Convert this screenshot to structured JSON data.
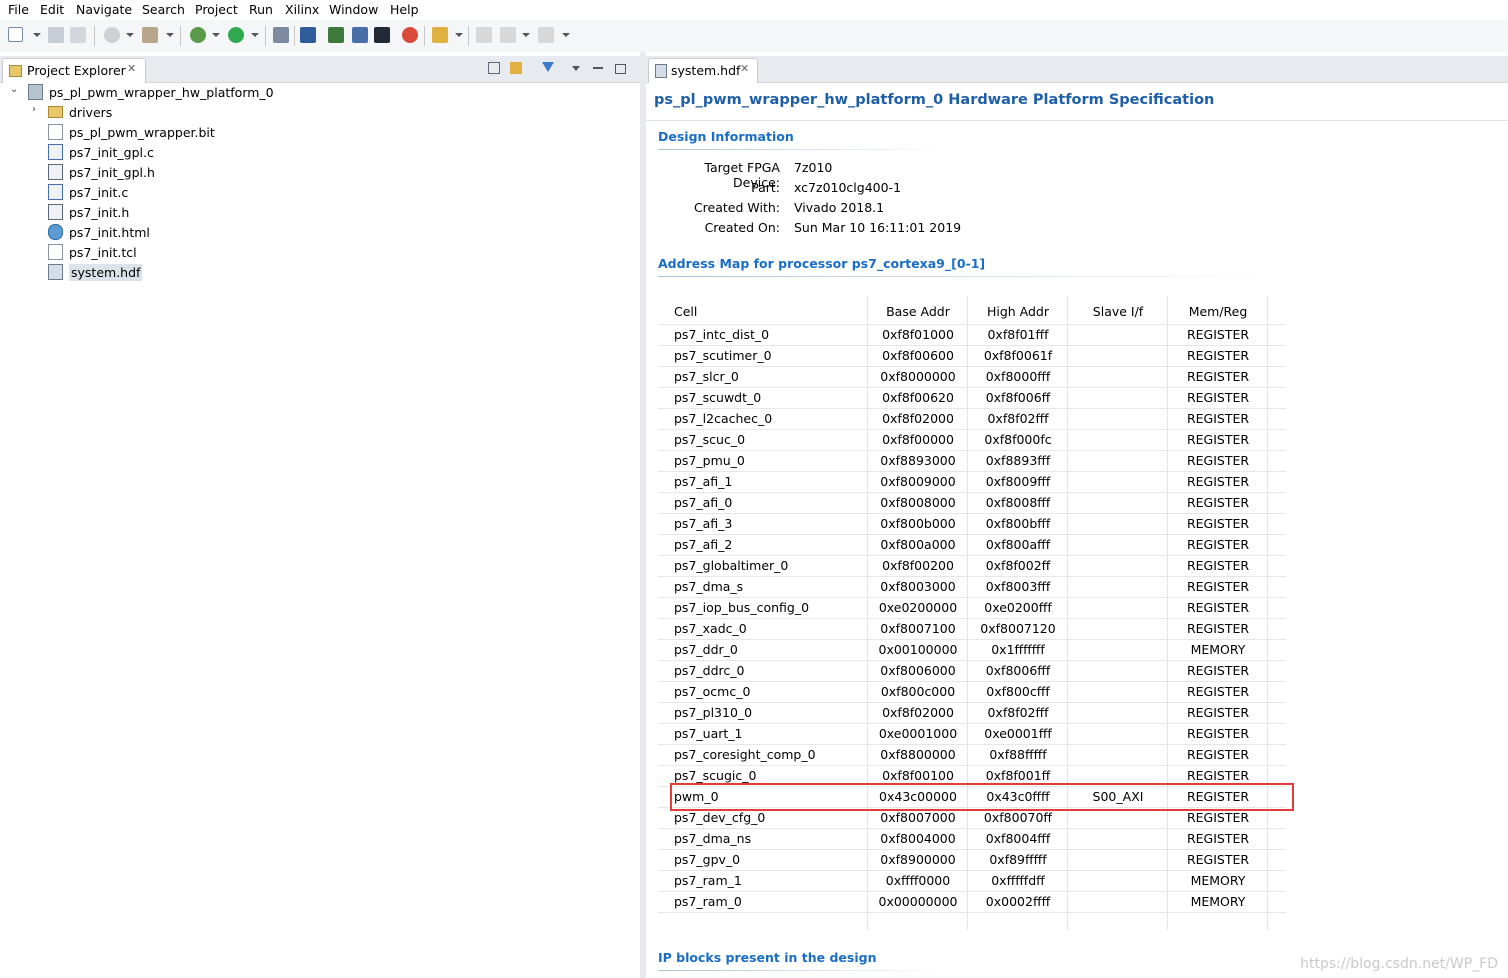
{
  "menu": [
    "File",
    "Edit",
    "Navigate",
    "Search",
    "Project",
    "Run",
    "Xilinx",
    "Window",
    "Help"
  ],
  "colors": {
    "accent": "#1a6dc5",
    "title": "#1f5fa8",
    "highlight": "#e23b3b",
    "selection": "#dde3ea"
  },
  "explorer": {
    "tab_label": "Project Explorer",
    "close_glyph": "✕",
    "root": "ps_pl_pwm_wrapper_hw_platform_0",
    "items": [
      {
        "label": "drivers",
        "icon": "folder-icon"
      },
      {
        "label": "ps_pl_pwm_wrapper.bit",
        "icon": "file-icon"
      },
      {
        "label": "ps7_init_gpl.c",
        "icon": "c-file-icon"
      },
      {
        "label": "ps7_init_gpl.h",
        "icon": "h-file-icon"
      },
      {
        "label": "ps7_init.c",
        "icon": "c-file-icon"
      },
      {
        "label": "ps7_init.h",
        "icon": "h-file-icon"
      },
      {
        "label": "ps7_init.html",
        "icon": "globe-icon"
      },
      {
        "label": "ps7_init.tcl",
        "icon": "file-icon"
      },
      {
        "label": "system.hdf",
        "icon": "hdf-file-icon"
      }
    ],
    "expand_glyph": "⌄",
    "collapsed_glyph": "›"
  },
  "editor": {
    "tab_label": "system.hdf",
    "close_glyph": "✕",
    "title": "ps_pl_pwm_wrapper_hw_platform_0 Hardware Platform Specification",
    "design_info_title": "Design Information",
    "design_info": [
      {
        "key": "Target FPGA Device:",
        "value": "7z010"
      },
      {
        "key": "Part:",
        "value": "xc7z010clg400-1"
      },
      {
        "key": "Created With:",
        "value": "Vivado 2018.1"
      },
      {
        "key": "Created On:",
        "value": "Sun Mar 10 16:11:01 2019"
      }
    ],
    "address_map_title": "Address Map for processor ps7_cortexa9_[0-1]",
    "columns": {
      "cell": "Cell",
      "base": "Base Addr",
      "high": "High Addr",
      "slave": "Slave I/f",
      "mem": "Mem/Reg"
    },
    "rows": [
      {
        "cell": "ps7_intc_dist_0",
        "base": "0xf8f01000",
        "high": "0xf8f01fff",
        "slave": "",
        "mem": "REGISTER"
      },
      {
        "cell": "ps7_scutimer_0",
        "base": "0xf8f00600",
        "high": "0xf8f0061f",
        "slave": "",
        "mem": "REGISTER"
      },
      {
        "cell": "ps7_slcr_0",
        "base": "0xf8000000",
        "high": "0xf8000fff",
        "slave": "",
        "mem": "REGISTER"
      },
      {
        "cell": "ps7_scuwdt_0",
        "base": "0xf8f00620",
        "high": "0xf8f006ff",
        "slave": "",
        "mem": "REGISTER"
      },
      {
        "cell": "ps7_l2cachec_0",
        "base": "0xf8f02000",
        "high": "0xf8f02fff",
        "slave": "",
        "mem": "REGISTER"
      },
      {
        "cell": "ps7_scuc_0",
        "base": "0xf8f00000",
        "high": "0xf8f000fc",
        "slave": "",
        "mem": "REGISTER"
      },
      {
        "cell": "ps7_pmu_0",
        "base": "0xf8893000",
        "high": "0xf8893fff",
        "slave": "",
        "mem": "REGISTER"
      },
      {
        "cell": "ps7_afi_1",
        "base": "0xf8009000",
        "high": "0xf8009fff",
        "slave": "",
        "mem": "REGISTER"
      },
      {
        "cell": "ps7_afi_0",
        "base": "0xf8008000",
        "high": "0xf8008fff",
        "slave": "",
        "mem": "REGISTER"
      },
      {
        "cell": "ps7_afi_3",
        "base": "0xf800b000",
        "high": "0xf800bfff",
        "slave": "",
        "mem": "REGISTER"
      },
      {
        "cell": "ps7_afi_2",
        "base": "0xf800a000",
        "high": "0xf800afff",
        "slave": "",
        "mem": "REGISTER"
      },
      {
        "cell": "ps7_globaltimer_0",
        "base": "0xf8f00200",
        "high": "0xf8f002ff",
        "slave": "",
        "mem": "REGISTER"
      },
      {
        "cell": "ps7_dma_s",
        "base": "0xf8003000",
        "high": "0xf8003fff",
        "slave": "",
        "mem": "REGISTER"
      },
      {
        "cell": "ps7_iop_bus_config_0",
        "base": "0xe0200000",
        "high": "0xe0200fff",
        "slave": "",
        "mem": "REGISTER"
      },
      {
        "cell": "ps7_xadc_0",
        "base": "0xf8007100",
        "high": "0xf8007120",
        "slave": "",
        "mem": "REGISTER"
      },
      {
        "cell": "ps7_ddr_0",
        "base": "0x00100000",
        "high": "0x1fffffff",
        "slave": "",
        "mem": "MEMORY"
      },
      {
        "cell": "ps7_ddrc_0",
        "base": "0xf8006000",
        "high": "0xf8006fff",
        "slave": "",
        "mem": "REGISTER"
      },
      {
        "cell": "ps7_ocmc_0",
        "base": "0xf800c000",
        "high": "0xf800cfff",
        "slave": "",
        "mem": "REGISTER"
      },
      {
        "cell": "ps7_pl310_0",
        "base": "0xf8f02000",
        "high": "0xf8f02fff",
        "slave": "",
        "mem": "REGISTER"
      },
      {
        "cell": "ps7_uart_1",
        "base": "0xe0001000",
        "high": "0xe0001fff",
        "slave": "",
        "mem": "REGISTER"
      },
      {
        "cell": "ps7_coresight_comp_0",
        "base": "0xf8800000",
        "high": "0xf88fffff",
        "slave": "",
        "mem": "REGISTER"
      },
      {
        "cell": "ps7_scugic_0",
        "base": "0xf8f00100",
        "high": "0xf8f001ff",
        "slave": "",
        "mem": "REGISTER"
      },
      {
        "cell": "pwm_0",
        "base": "0x43c00000",
        "high": "0x43c0ffff",
        "slave": "S00_AXI",
        "mem": "REGISTER"
      },
      {
        "cell": "ps7_dev_cfg_0",
        "base": "0xf8007000",
        "high": "0xf80070ff",
        "slave": "",
        "mem": "REGISTER"
      },
      {
        "cell": "ps7_dma_ns",
        "base": "0xf8004000",
        "high": "0xf8004fff",
        "slave": "",
        "mem": "REGISTER"
      },
      {
        "cell": "ps7_gpv_0",
        "base": "0xf8900000",
        "high": "0xf89fffff",
        "slave": "",
        "mem": "REGISTER"
      },
      {
        "cell": "ps7_ram_1",
        "base": "0xffff0000",
        "high": "0xfffffdff",
        "slave": "",
        "mem": "MEMORY"
      },
      {
        "cell": "ps7_ram_0",
        "base": "0x00000000",
        "high": "0x0002ffff",
        "slave": "",
        "mem": "MEMORY"
      }
    ],
    "ip_blocks_title": "IP blocks present in the design"
  },
  "watermark": "https://blog.csdn.net/WP_FD"
}
